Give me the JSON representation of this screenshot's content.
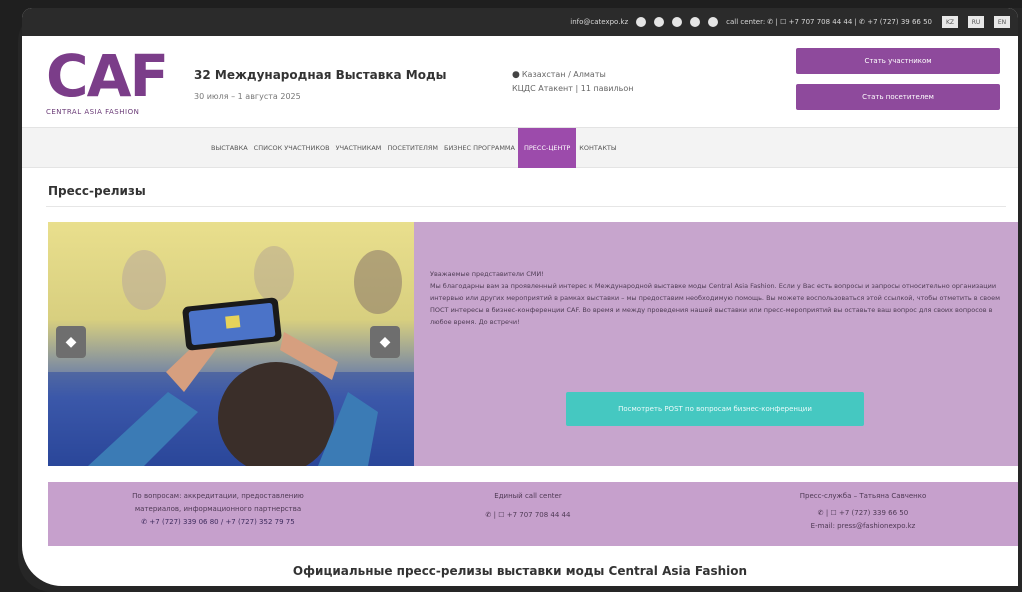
{
  "topbar": {
    "email": "info@catexpo.kz",
    "callcenter": "call center: ✆ | ☐ +7 707 708 44 44 | ✆ +7 (727) 39 66 50",
    "languages": [
      "KZ",
      "RU",
      "EN"
    ]
  },
  "header": {
    "logo_main": "CAF",
    "logo_sub": "CENTRAL ASIA FASHION",
    "exhibition_title": "32 Международная Выставка Моды",
    "exhibition_dates": "30 июля – 1 августа 2025",
    "location_line1": "Казахстан / Алматы",
    "location_line2": "КЦДС Атакент | 11 павильон",
    "btn_exhibitor": "Стать участником",
    "btn_visitor": "Стать посетителем"
  },
  "nav": {
    "items": [
      "ВЫСТАВКА",
      "СПИСОК УЧАСТНИКОВ",
      "УЧАСТНИКАМ",
      "ПОСЕТИТЕЛЯМ",
      "БИЗНЕС ПРОГРАММА",
      "ПРЕСС-ЦЕНТР",
      "КОНТАКТЫ"
    ],
    "active": "ПРЕСС-ЦЕНТР"
  },
  "page": {
    "title": "Пресс-релизы",
    "footer_title": "Официальные пресс-релизы выставки моды Central Asia Fashion"
  },
  "banner": {
    "intro": "Уважаемые представители СМИ!",
    "body": "Мы благодарны вам за проявленный интерес к Международной выставке моды Central Asia Fashion. Если у Вас есть вопросы и запросы относительно организации интервью или других мероприятий в рамках выставки – мы предоставим необходимую помощь. Вы можете воспользоваться этой ссылкой, чтобы отметить в своем ПОСТ интересы в бизнес-конференции CAF. Во время и между проведения нашей выставки или пресс-мероприятий вы оставьте ваш вопрос для своих вопросов в любое время. До встречи!",
    "cta": "Посмотреть POST по вопросам бизнес-конференции"
  },
  "contacts": {
    "col1_line1": "По вопросам: аккредитации, предоставлению",
    "col1_line2": "материалов, информационного партнерства",
    "col1_phone": "✆ +7 (727) 339 06 80 / +7 (727) 352 79 75",
    "col2_title": "Единый call center",
    "col2_phone": "✆ | ☐ +7 707 708 44 44",
    "col3_title": "Пресс-служба – Татьяна Савченко",
    "col3_phone": "✆ | ☐ +7 (727) 339 66 50",
    "col3_email": "E-mail: press@fashionexpo.kz"
  },
  "colors": {
    "purple": "#8e4a9c",
    "panel": "#c7a5cd",
    "teal": "#45c8c1"
  }
}
